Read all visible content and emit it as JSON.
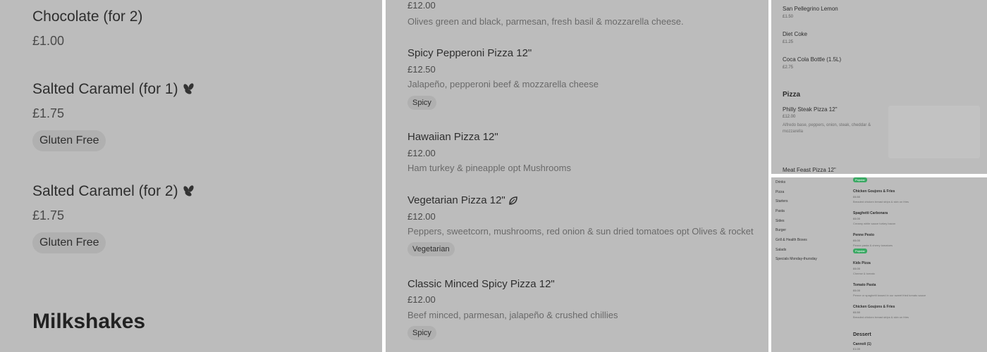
{
  "panel1": {
    "items": [
      {
        "name": "Chocolate (for 2)",
        "price": "£1.00"
      },
      {
        "name": "Salted Caramel (for 1)",
        "price": "£1.75",
        "tag": "Gluten Free",
        "icon": "leaf-cluster-icon"
      },
      {
        "name": "Salted Caramel (for 2)",
        "price": "£1.75",
        "tag": "Gluten Free",
        "icon": "leaf-cluster-icon"
      }
    ],
    "section_heading": "Milkshakes"
  },
  "panel2": {
    "top_price": "£12.00",
    "top_desc": "Olives green and black, parmesan, fresh basil & mozzarella cheese.",
    "items": [
      {
        "name": "Spicy Pepperoni Pizza 12\"",
        "price": "£12.50",
        "desc": "Jalapeño, pepperoni beef & mozzarella cheese",
        "tag": "Spicy"
      },
      {
        "name": "Hawaiian Pizza 12\"",
        "price": "£12.00",
        "desc": "Ham turkey & pineapple opt Mushrooms"
      },
      {
        "name": "Vegetarian Pizza 12\"",
        "price": "£12.00",
        "desc": "Peppers, sweetcorn, mushrooms, red onion & sun dried tomatoes opt Olives & rocket",
        "tag": "Vegetarian",
        "icon": "leaf-icon"
      },
      {
        "name": "Classic Minced Spicy Pizza 12\"",
        "price": "£12.00",
        "desc": "Beef minced, parmesan, jalapeño & crushed chillies",
        "tag": "Spicy"
      }
    ]
  },
  "panel3": {
    "drinks": [
      {
        "name": "San Pellegrino Lemon",
        "price": "£1.50"
      },
      {
        "name": "Diet Coke",
        "price": "£1.25"
      },
      {
        "name": "Coca Cola Bottle (1.5L)",
        "price": "£2.75"
      }
    ],
    "section": "Pizza",
    "pizza": {
      "name": "Philly Steak Pizza 12\"",
      "price": "£12.00",
      "desc": "Alfredo base, peppers, onion, steak, cheddar & mozzarella"
    },
    "next": "Meat Feast Pizza 12\""
  },
  "panel4": {
    "nav": [
      "Drinks",
      "Pizza",
      "Starters",
      "Pasta",
      "Sides",
      "Burger",
      "Grill & Health Boxes",
      "Salads",
      "Specials Monday-thursday"
    ],
    "badge_top": "Popular",
    "items": [
      {
        "name": "Chicken Goujons & Fries",
        "price": "£6.50",
        "desc": "Breaded chicken breast strips & skin on fries"
      },
      {
        "name": "Spaghetti Carbonara",
        "price": "£6.00",
        "desc": "Creamy white sauce turkey bacon"
      },
      {
        "name": "Penne Pesto",
        "price": "£6.00",
        "desc": "Penne pasta & cherry tomatoes",
        "badge": "Popular"
      },
      {
        "name": "Kids Pizza",
        "price": "£6.00",
        "desc": "Cheese & tomato"
      },
      {
        "name": "Tomato Pasta",
        "price": "£6.00",
        "desc": "Penne or spaghetti tossed in our sweet fried tomato sauce"
      },
      {
        "name": "Chicken Goujons & Fries",
        "price": "£6.50",
        "desc": "Breaded chicken breast strips & skin on fries"
      }
    ],
    "section": "Dessert",
    "dessert_first": {
      "name": "Cannoli (1)",
      "price": "£1.00"
    }
  },
  "colors": {
    "panel_bg": "#bcbcbc",
    "tag_bg": "#b0b0b0",
    "badge": "#3aa863"
  }
}
